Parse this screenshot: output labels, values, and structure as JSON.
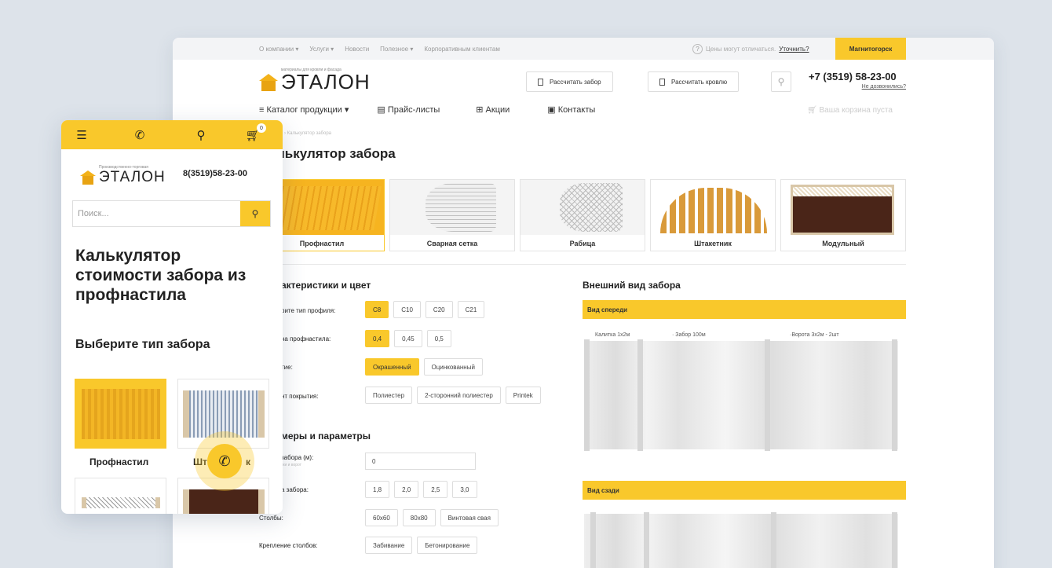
{
  "topbar": {
    "nav": [
      "О компании ▾",
      "Услуги ▾",
      "Новости",
      "Полезное ▾",
      "Корпоративным клиентам"
    ],
    "prices_note": "Цены могут отличаться.",
    "clarify": "Уточнить?",
    "city": "Магнитогорск"
  },
  "header": {
    "logo_tagline": "материалы для кровли и фасада",
    "logo": "ЭТАЛОН",
    "btn_fence": "Рассчитать забор",
    "btn_roof": "Рассчитать кровлю",
    "phone": "+7 (3519) 58-23-00",
    "callback": "Не дозвонились?"
  },
  "menu": {
    "catalog": "≡ Каталог продукции ▾",
    "prices": "▤ Прайс-листы",
    "promo": "⊞ Акции",
    "contacts": "▣ Контакты",
    "cart": "Ваша корзина пуста"
  },
  "breadcrumb": "› Калькулятор забора",
  "page_title": "лькулятор забора",
  "fence_types": [
    "Профнастил",
    "Сварная сетка",
    "Рабица",
    "Штакетник",
    "Модульный"
  ],
  "section1": {
    "title": "актеристики и цвет",
    "profile_label": "рите тип профиля:",
    "profiles": [
      "С8",
      "С10",
      "С20",
      "С21"
    ],
    "thickness_label": "на профнастила:",
    "thickness": [
      "0,4",
      "0,45",
      "0,5"
    ],
    "coating_label": "тие:",
    "coatings": [
      "Окрашенный",
      "Оцинкованный"
    ],
    "variant_label": "нт покрытия:",
    "variants": [
      "Полиестер",
      "2-сторонний полиестер",
      "Printek"
    ]
  },
  "section2": {
    "title": "меры и параметры",
    "length_label": "забора (м):",
    "length_sub": "тки и ворот",
    "length_value": "0",
    "height_label": "а забора:",
    "heights": [
      "1,8",
      "2,0",
      "2,5",
      "3,0"
    ],
    "posts_label": "Столбы:",
    "posts": [
      "60х60",
      "80х80",
      "Винтовая свая"
    ],
    "mount_label": "Крепление столбов:",
    "mounts": [
      "Забивание",
      "Бетонирование"
    ]
  },
  "preview": {
    "title": "Внешний вид забора",
    "front": "Вид спереди",
    "front_labels": [
      "Калитка 1х2м",
      "· Забор 100м",
      "·Ворота 3х2м - 2шт"
    ],
    "back": "Вид сзади"
  },
  "mobile": {
    "logo_tagline": "Производственно-торговая",
    "logo": "ЭТАЛОН",
    "phone": "8(3519)58-23-00",
    "cart_count": "0",
    "search_placeholder": "Поиск...",
    "title": "Калькулятор стоимости забора из профнастила",
    "subtitle": "Выберите тип забора",
    "card1": "Профнастил",
    "card2_a": "Шт",
    "card2_b": "к"
  },
  "colors": {
    "accent": "#f9c82b",
    "accent_dark": "#f6b420"
  },
  "icons": {
    "menu": "hamburger-icon",
    "phone": "phone-icon",
    "pin": "map-pin-icon",
    "cart": "cart-icon",
    "search": "search-icon",
    "call": "call-icon"
  }
}
